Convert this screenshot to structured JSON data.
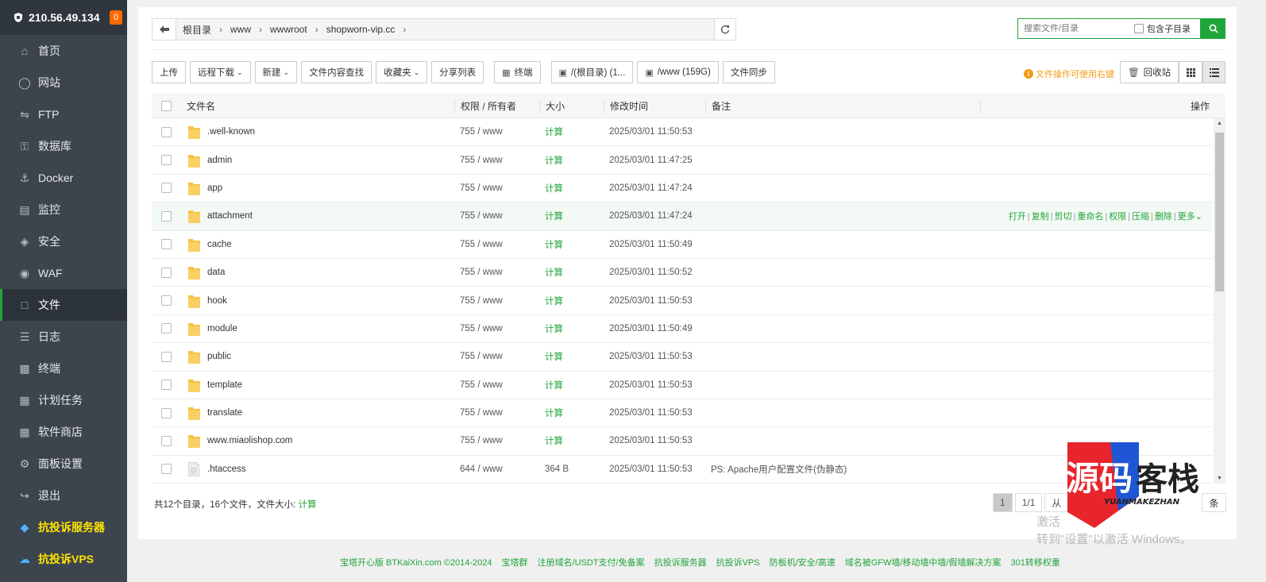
{
  "sidebar": {
    "ip": "210.56.49.134",
    "badge": "0",
    "items": [
      {
        "label": "首页",
        "icon": "home-icon"
      },
      {
        "label": "网站",
        "icon": "globe-icon"
      },
      {
        "label": "FTP",
        "icon": "ftp-icon"
      },
      {
        "label": "数据库",
        "icon": "database-icon"
      },
      {
        "label": "Docker",
        "icon": "docker-icon"
      },
      {
        "label": "监控",
        "icon": "monitor-icon"
      },
      {
        "label": "安全",
        "icon": "shield-icon"
      },
      {
        "label": "WAF",
        "icon": "waf-icon"
      },
      {
        "label": "文件",
        "icon": "folder-icon"
      },
      {
        "label": "日志",
        "icon": "log-icon"
      },
      {
        "label": "终端",
        "icon": "terminal-icon"
      },
      {
        "label": "计划任务",
        "icon": "calendar-icon"
      },
      {
        "label": "软件商店",
        "icon": "apps-icon"
      },
      {
        "label": "面板设置",
        "icon": "settings-icon"
      },
      {
        "label": "退出",
        "icon": "logout-icon"
      },
      {
        "label": "抗投诉服务器",
        "icon": "layers-icon"
      },
      {
        "label": "抗投诉VPS",
        "icon": "cloud-icon"
      }
    ]
  },
  "path": {
    "crumbs": [
      "根目录",
      "www",
      "wwwroot",
      "shopworn-vip.cc"
    ]
  },
  "search": {
    "placeholder": "搜索文件/目录",
    "subdir_label": "包含子目录"
  },
  "toolbar": {
    "upload": "上传",
    "remote_download": "远程下载",
    "new": "新建",
    "content_search": "文件内容查找",
    "favorites": "收藏夹",
    "share_list": "分享列表",
    "terminal": "终端",
    "disk_root": "/(根目录) (1...",
    "disk_www": "/www (159G)",
    "file_sync": "文件同步",
    "tip": "文件操作可使用右键",
    "recycle": "回收站"
  },
  "table": {
    "headers": {
      "name": "文件名",
      "perm": "权限 / 所有者",
      "size": "大小",
      "time": "修改时间",
      "note": "备注",
      "ops": "操作"
    },
    "rows": [
      {
        "name": ".well-known",
        "perm": "755 / www",
        "size": "计算",
        "time": "2025/03/01 11:50:53",
        "note": "",
        "type": "folder"
      },
      {
        "name": "admin",
        "perm": "755 / www",
        "size": "计算",
        "time": "2025/03/01 11:47:25",
        "note": "",
        "type": "folder"
      },
      {
        "name": "app",
        "perm": "755 / www",
        "size": "计算",
        "time": "2025/03/01 11:47:24",
        "note": "",
        "type": "folder"
      },
      {
        "name": "attachment",
        "perm": "755 / www",
        "size": "计算",
        "time": "2025/03/01 11:47:24",
        "note": "",
        "type": "folder"
      },
      {
        "name": "cache",
        "perm": "755 / www",
        "size": "计算",
        "time": "2025/03/01 11:50:49",
        "note": "",
        "type": "folder"
      },
      {
        "name": "data",
        "perm": "755 / www",
        "size": "计算",
        "time": "2025/03/01 11:50:52",
        "note": "",
        "type": "folder"
      },
      {
        "name": "hook",
        "perm": "755 / www",
        "size": "计算",
        "time": "2025/03/01 11:50:53",
        "note": "",
        "type": "folder"
      },
      {
        "name": "module",
        "perm": "755 / www",
        "size": "计算",
        "time": "2025/03/01 11:50:49",
        "note": "",
        "type": "folder"
      },
      {
        "name": "public",
        "perm": "755 / www",
        "size": "计算",
        "time": "2025/03/01 11:50:53",
        "note": "",
        "type": "folder"
      },
      {
        "name": "template",
        "perm": "755 / www",
        "size": "计算",
        "time": "2025/03/01 11:50:53",
        "note": "",
        "type": "folder"
      },
      {
        "name": "translate",
        "perm": "755 / www",
        "size": "计算",
        "time": "2025/03/01 11:50:53",
        "note": "",
        "type": "folder"
      },
      {
        "name": "www.miaolishop.com",
        "perm": "755 / www",
        "size": "计算",
        "time": "2025/03/01 11:50:53",
        "note": "",
        "type": "folder"
      },
      {
        "name": ".htaccess",
        "perm": "644 / www",
        "size": "364 B",
        "time": "2025/03/01 11:50:53",
        "note": "PS: Apache用户配置文件(伪静态)",
        "type": "file"
      }
    ],
    "hover_ops": [
      "打开",
      "复制",
      "剪切",
      "重命名",
      "权限",
      "压缩",
      "删除",
      "更多"
    ]
  },
  "summary": {
    "text": "共12个目录，16个文件，文件大小:",
    "calc": "计算"
  },
  "pager": {
    "current": "1",
    "total": "1/1",
    "from": "从",
    "unit": "条"
  },
  "watermark": {
    "logo_text": "源码客栈",
    "logo_sub": "YUANMAKEZHAN",
    "win_line1": "激活",
    "win_line2": "转到\"设置\"以激活 Windows。"
  },
  "footer": {
    "items": [
      "宝塔开心版 BTKaiXin.com ©2014-2024",
      "宝塔群",
      "注册域名/USDT支付/免备案",
      "抗投诉服务器",
      "抗投诉VPS",
      "防板机/安全/高速",
      "域名被GFW墙/移动墙中墙/假墙解决方案",
      "301转移权重"
    ]
  },
  "colors": {
    "accent": "#20a53a",
    "sidebar": "#3c444d",
    "warn": "#f39c12",
    "badge": "#ff6a00"
  }
}
